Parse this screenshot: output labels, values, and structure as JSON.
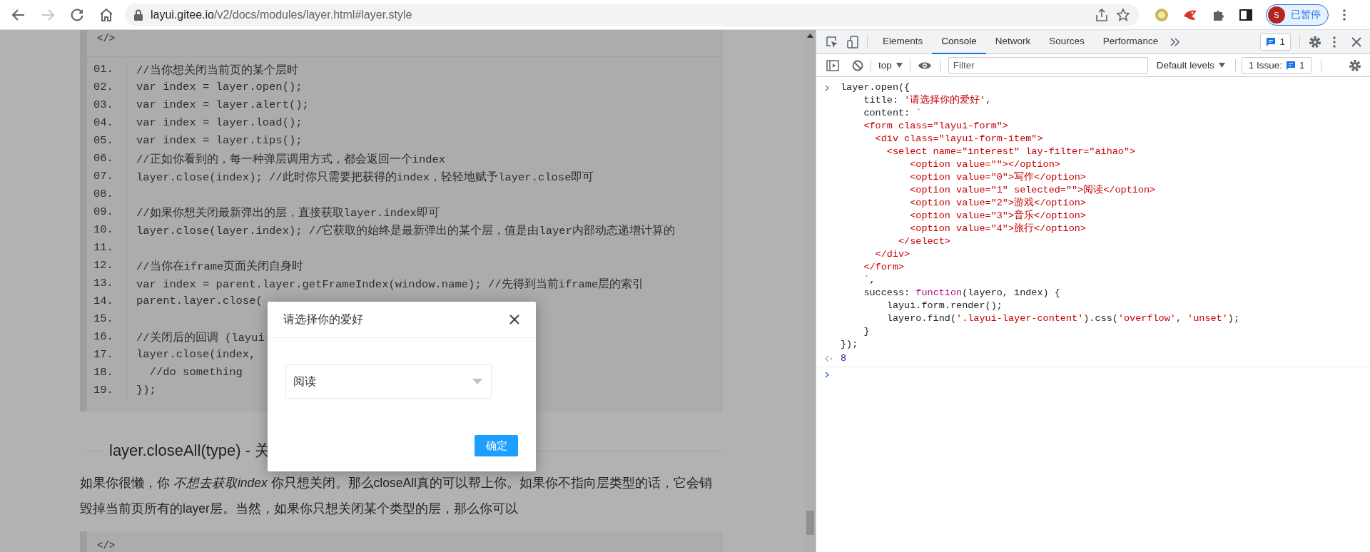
{
  "browser": {
    "url_host": "layui.gitee.io",
    "url_path": "/v2/docs/modules/layer.html#layer.style",
    "forward_disabled": true,
    "profile_initial": "S",
    "profile_status": "已暂停"
  },
  "page": {
    "code_top_label": "</>",
    "code_lines": [
      {
        "number": "01.",
        "text": "//当你想关闭当前页的某个层时"
      },
      {
        "number": "02.",
        "text": "var index = layer.open();"
      },
      {
        "number": "03.",
        "text": "var index = layer.alert();"
      },
      {
        "number": "04.",
        "text": "var index = layer.load();"
      },
      {
        "number": "05.",
        "text": "var index = layer.tips();"
      },
      {
        "number": "06.",
        "text": "//正如你看到的，每一种弹层调用方式，都会返回一个index"
      },
      {
        "number": "07.",
        "text": "layer.close(index); //此时你只需要把获得的index，轻轻地赋予layer.close即可"
      },
      {
        "number": "08."
      },
      {
        "number": "09.",
        "text": "//如果你想关闭最新弹出的层，直接获取layer.index即可"
      },
      {
        "number": "10.",
        "text": "layer.close(layer.index); //它获取的始终是最新弹出的某个层，值是由layer内部动态递增计算的"
      },
      {
        "number": "11."
      },
      {
        "number": "12.",
        "text": "//当你在iframe页面关闭自身时"
      },
      {
        "number": "13.",
        "text": "var index = parent.layer.getFrameIndex(window.name); //先得到当前iframe层的索引"
      },
      {
        "number": "14.",
        "text": "parent.layer.close("
      },
      {
        "number": "15."
      },
      {
        "number": "16.",
        "text": "//关闭后的回调 (layui"
      },
      {
        "number": "17.",
        "text": "layer.close(index,"
      },
      {
        "number": "18.",
        "text": "  //do something"
      },
      {
        "number": "19.",
        "text": "});"
      }
    ],
    "heading": "layer.closeAll(type) - 关",
    "paragraph": "如果你很懒，你 *不想去获取index* 你只想关闭。那么closeAll真的可以帮上你。如果你不指向层类型的话，它会销毁掉当前页所有的layer层。当然，如果你只想关闭某个类型的层，那么你可以",
    "code_bottom_label": "</>"
  },
  "dialog": {
    "title": "请选择你的爱好",
    "select_value": "阅读",
    "button": "确定"
  },
  "devtools": {
    "tabs": [
      {
        "label": "Elements",
        "selected": false
      },
      {
        "label": "Console",
        "selected": true
      },
      {
        "label": "Network",
        "selected": false
      },
      {
        "label": "Sources",
        "selected": false
      },
      {
        "label": "Performance",
        "selected": false
      }
    ],
    "messages_count": "1",
    "toolbar": {
      "context": "top",
      "filter_placeholder": "Filter",
      "levels": "Default levels",
      "issues_label": "1 Issue:",
      "issues_count": "1"
    },
    "console": {
      "input_lines": [
        [
          {
            "kind": "plain",
            "text": "layer.open({"
          }
        ],
        [
          {
            "kind": "plain",
            "text": "    title: "
          },
          {
            "kind": "string",
            "text": "'请选择你的爱好'"
          },
          {
            "kind": "plain",
            "text": ","
          }
        ],
        [
          {
            "kind": "plain",
            "text": "    content: "
          },
          {
            "kind": "string",
            "text": "`"
          }
        ],
        [
          {
            "kind": "string",
            "text": "    <form class=\"layui-form\">"
          }
        ],
        [
          {
            "kind": "string",
            "text": "      <div class=\"layui-form-item\">"
          }
        ],
        [
          {
            "kind": "string",
            "text": "        <select name=\"interest\" lay-filter=\"aihao\">"
          }
        ],
        [
          {
            "kind": "string",
            "text": "            <option value=\"\"></option>"
          }
        ],
        [
          {
            "kind": "string",
            "text": "            <option value=\"0\">写作</option>"
          }
        ],
        [
          {
            "kind": "string",
            "text": "            <option value=\"1\" selected=\"\">阅读</option>"
          }
        ],
        [
          {
            "kind": "string",
            "text": "            <option value=\"2\">游戏</option>"
          }
        ],
        [
          {
            "kind": "string",
            "text": "            <option value=\"3\">音乐</option>"
          }
        ],
        [
          {
            "kind": "string",
            "text": "            <option value=\"4\">旅行</option>"
          }
        ],
        [
          {
            "kind": "string",
            "text": "          </select>"
          }
        ],
        [
          {
            "kind": "string",
            "text": "      </div>"
          }
        ],
        [
          {
            "kind": "string",
            "text": "    </form>"
          }
        ],
        [
          {
            "kind": "string",
            "text": "    `"
          },
          {
            "kind": "plain",
            "text": ","
          }
        ],
        [
          {
            "kind": "plain",
            "text": "    success: "
          },
          {
            "kind": "keyword",
            "text": "function"
          },
          {
            "kind": "plain",
            "text": "(layero, index) {"
          }
        ],
        [
          {
            "kind": "plain",
            "text": "        layui.form.render();"
          }
        ],
        [
          {
            "kind": "plain",
            "text": "        layero.find("
          },
          {
            "kind": "string",
            "text": "'.layui-layer-content'"
          },
          {
            "kind": "plain",
            "text": ").css("
          },
          {
            "kind": "string",
            "text": "'overflow'"
          },
          {
            "kind": "plain",
            "text": ", "
          },
          {
            "kind": "string",
            "text": "'unset'"
          },
          {
            "kind": "plain",
            "text": ");"
          }
        ],
        [
          {
            "kind": "plain",
            "text": "    }"
          }
        ],
        [
          {
            "kind": "plain",
            "text": "});"
          }
        ]
      ],
      "result": "8"
    }
  }
}
